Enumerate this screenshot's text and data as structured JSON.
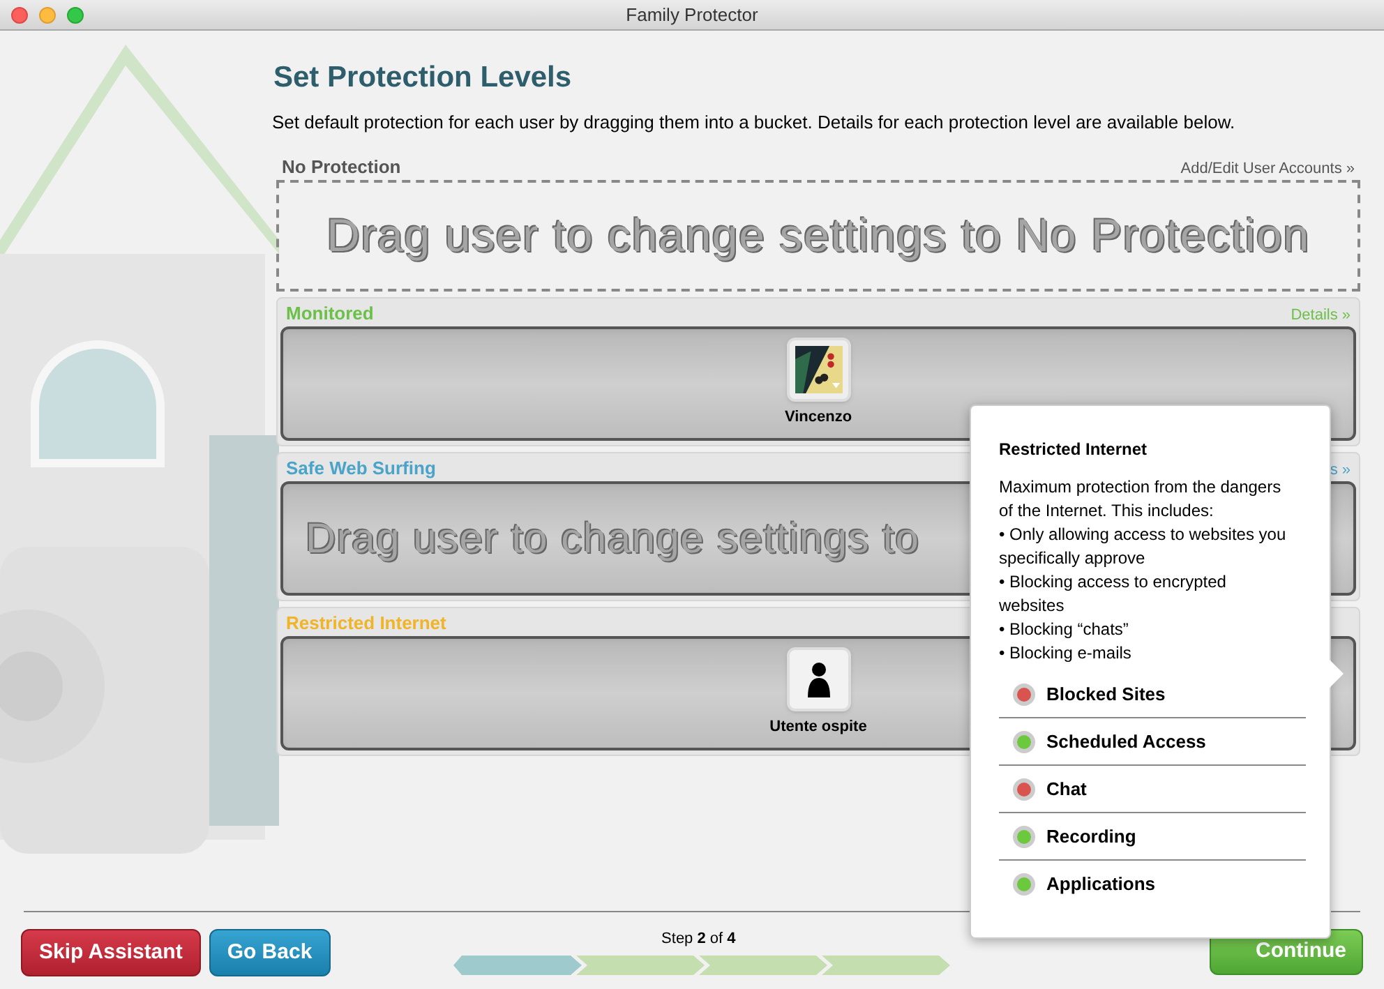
{
  "window": {
    "title": "Family Protector"
  },
  "heading": "Set Protection Levels",
  "intro": "Set default protection for each user by dragging them into a bucket. Details for each protection level are available below.",
  "buckets": [
    {
      "label": "No Protection",
      "kind": "dashed",
      "color": "#555555",
      "link": "Add/Edit User Accounts »",
      "hint": "Drag user to change settings to No Protection"
    },
    {
      "label": "Monitored",
      "kind": "well",
      "color": "#6cc04a",
      "link": "Details »",
      "users": [
        {
          "name": "Vincenzo"
        }
      ]
    },
    {
      "label": "Safe Web Surfing",
      "kind": "well",
      "color": "#4aa3c8",
      "link": "s »",
      "hint": "Drag user to change settings to"
    },
    {
      "label": "Restricted Internet",
      "kind": "well",
      "color": "#f0b429",
      "users": [
        {
          "name": "Utente ospite",
          "kind": "silhouette"
        }
      ]
    }
  ],
  "popover": {
    "title": "Restricted Internet",
    "lines": [
      "Maximum protection from the dangers of the Internet. This includes:",
      "• Only allowing access to websites you specifically approve",
      "•  Blocking access to encrypted websites",
      "• Blocking “chats”",
      "• Blocking e-mails"
    ],
    "features": [
      {
        "label": "Blocked Sites",
        "color": "#d9534f"
      },
      {
        "label": "Scheduled Access",
        "color": "#6cc83c"
      },
      {
        "label": "Chat",
        "color": "#d9534f"
      },
      {
        "label": "Recording",
        "color": "#6cc83c"
      },
      {
        "label": "Applications",
        "color": "#6cc83c"
      }
    ]
  },
  "footer": {
    "buttons": [
      {
        "label": "Skip Assistant",
        "kind": "danger"
      },
      {
        "label": "Go Back",
        "kind": "info"
      }
    ],
    "step": "Step **2** of **4**",
    "segments": [
      {
        "done": true
      },
      {
        "done": false
      },
      {
        "done": false
      },
      {
        "done": false
      }
    ],
    "continue": "Continue"
  }
}
